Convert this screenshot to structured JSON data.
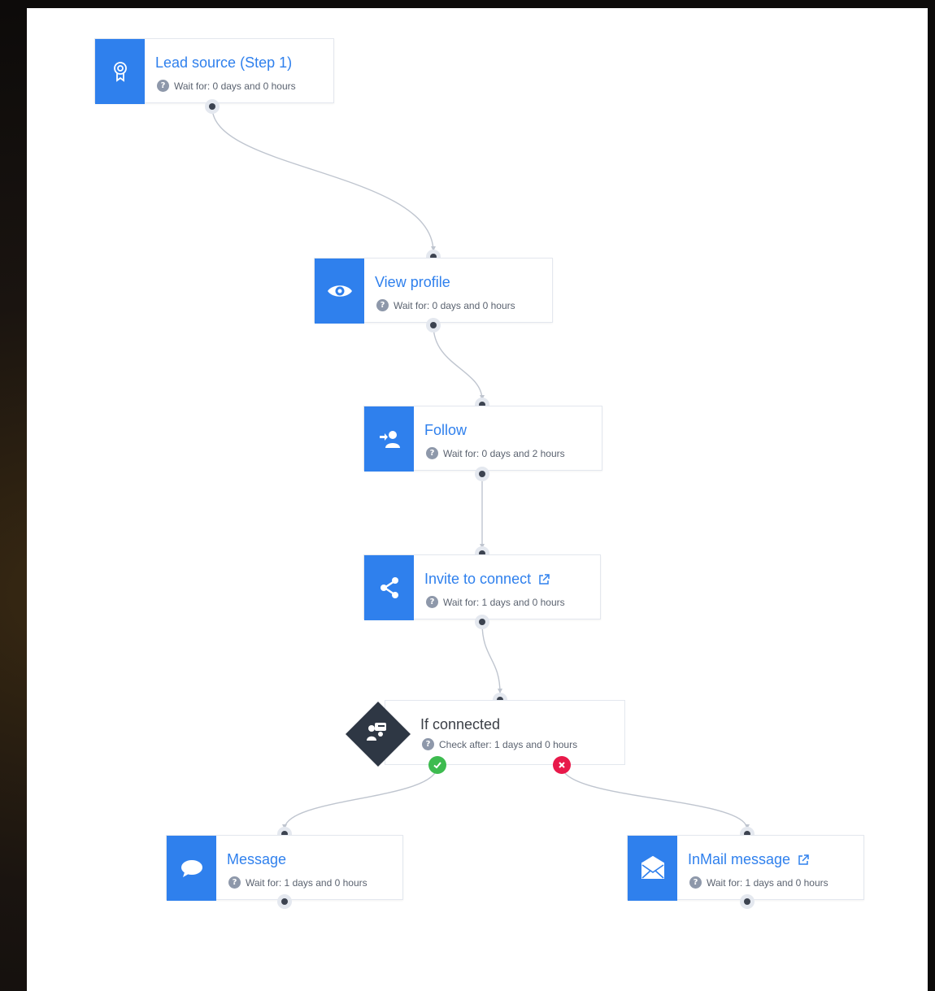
{
  "colors": {
    "accent": "#2f80ed",
    "yes": "#3dbb4f",
    "no": "#e8194a",
    "condition": "#2e3744"
  },
  "nodes": {
    "lead_source": {
      "title": "Lead source (Step 1)",
      "wait": "Wait for: 0 days and 0 hours",
      "icon": "lead-source-icon"
    },
    "view_profile": {
      "title": "View profile",
      "wait": "Wait for: 0 days and 0 hours",
      "icon": "eye-icon"
    },
    "follow": {
      "title": "Follow",
      "wait": "Wait for: 0 days and 2 hours",
      "icon": "follow-user-icon"
    },
    "invite": {
      "title": "Invite to connect",
      "wait": "Wait for: 1 days and 0 hours",
      "icon": "share-icon"
    },
    "if_connected": {
      "title": "If connected",
      "wait": "Check after: 1 days and 0 hours",
      "icon": "connected-users-icon"
    },
    "message": {
      "title": "Message",
      "wait": "Wait for: 1 days and 0 hours",
      "icon": "chat-bubble-icon"
    },
    "inmail": {
      "title": "InMail message",
      "wait": "Wait for: 1 days and 0 hours",
      "icon": "envelope-icon"
    }
  }
}
